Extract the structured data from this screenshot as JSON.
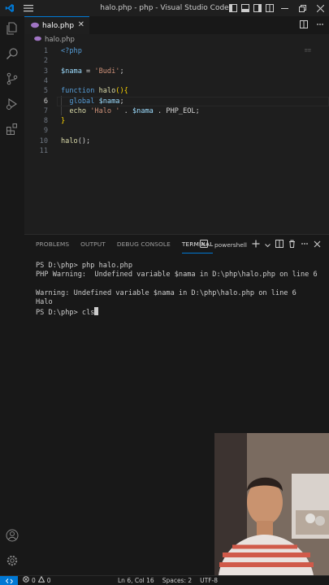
{
  "window": {
    "title": "halo.php - php - Visual Studio Code"
  },
  "tab": {
    "label": "halo.php",
    "close": "✕"
  },
  "breadcrumb": {
    "file": "halo.php"
  },
  "editor": {
    "lines": [
      {
        "n": "1",
        "tokens": [
          [
            "tag",
            "<?php"
          ]
        ]
      },
      {
        "n": "2",
        "tokens": []
      },
      {
        "n": "3",
        "tokens": [
          [
            "var",
            "$nama"
          ],
          [
            "op",
            " = "
          ],
          [
            "str",
            "'Budi'"
          ],
          [
            "op",
            ";"
          ]
        ]
      },
      {
        "n": "4",
        "tokens": []
      },
      {
        "n": "5",
        "tokens": [
          [
            "kw",
            "function "
          ],
          [
            "fn",
            "halo"
          ],
          [
            "brace",
            "(){"
          ]
        ]
      },
      {
        "n": "6",
        "tokens": [
          [
            "op",
            "  "
          ],
          [
            "kw",
            "global "
          ],
          [
            "var",
            "$nama"
          ],
          [
            "op",
            ";"
          ]
        ]
      },
      {
        "n": "7",
        "tokens": [
          [
            "op",
            "  "
          ],
          [
            "fn",
            "echo "
          ],
          [
            "str",
            "'Halo '"
          ],
          [
            "op",
            " . "
          ],
          [
            "var",
            "$nama"
          ],
          [
            "op",
            " . "
          ],
          [
            "const",
            "PHP_EOL"
          ],
          [
            "op",
            ";"
          ]
        ]
      },
      {
        "n": "8",
        "tokens": [
          [
            "brace",
            "}"
          ]
        ]
      },
      {
        "n": "9",
        "tokens": []
      },
      {
        "n": "10",
        "tokens": [
          [
            "fn",
            "halo"
          ],
          [
            "op",
            "();"
          ]
        ]
      },
      {
        "n": "11",
        "tokens": []
      }
    ],
    "active_line": "6"
  },
  "panel": {
    "tabs": [
      "PROBLEMS",
      "OUTPUT",
      "DEBUG CONSOLE",
      "TERMINAL"
    ],
    "active_tab": "TERMINAL",
    "shell": "powershell",
    "terminal_lines": [
      "PS D:\\php> php halo.php",
      "PHP Warning:  Undefined variable $nama in D:\\php\\halo.php on line 6",
      "",
      "Warning: Undefined variable $nama in D:\\php\\halo.php on line 6",
      "Halo",
      "PS D:\\php> cls"
    ]
  },
  "statusbar": {
    "errors": "0",
    "warnings": "0",
    "position": "Ln 6, Col 16",
    "spaces": "Spaces: 2",
    "encoding": "UTF-8"
  },
  "colors": {
    "accent": "#0078d4",
    "background": "#1e1e1e",
    "activitybar": "#181818"
  },
  "icons": [
    "vscode-logo-icon",
    "menu-icon",
    "explorer-icon",
    "search-icon",
    "source-control-icon",
    "run-debug-icon",
    "extensions-icon",
    "account-icon",
    "settings-gear-icon",
    "php-file-icon",
    "split-editor-icon",
    "more-icon",
    "terminal-icon",
    "add-icon",
    "chevron-down-icon",
    "split-terminal-icon",
    "trash-icon",
    "ellipsis-icon",
    "close-icon",
    "error-icon",
    "warning-icon"
  ]
}
